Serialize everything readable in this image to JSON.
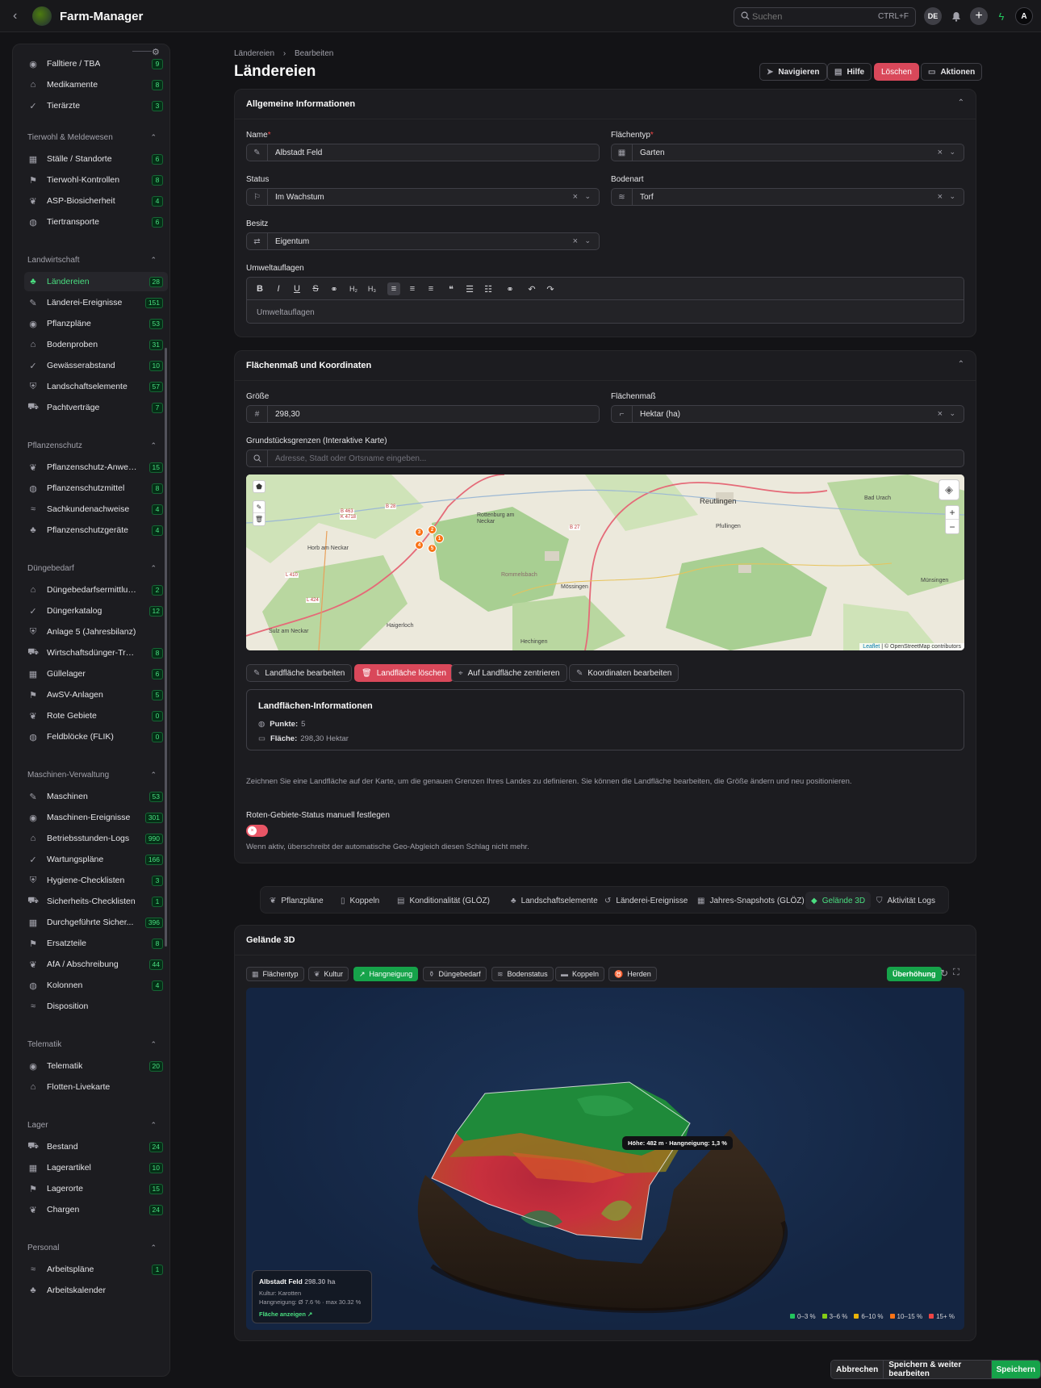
{
  "app": {
    "title": "Farm-Manager",
    "back_icon": "chevron-left-icon"
  },
  "topbar": {
    "search_placeholder": "Suchen",
    "search_shortcut": "CTRL+F",
    "lang": "DE",
    "avatar": "A"
  },
  "sidebar": {
    "items_top": [
      {
        "label": "Falltiere / TBA",
        "count": "9",
        "icon": "skull-icon"
      },
      {
        "label": "Medikamente",
        "count": "8",
        "icon": "pill-icon"
      },
      {
        "label": "Tierärzte",
        "count": "3",
        "icon": "stethoscope-icon"
      }
    ],
    "sections": [
      {
        "title": "Tierwohl & Meldewesen",
        "items": [
          {
            "label": "Ställe / Standorte",
            "count": "6"
          },
          {
            "label": "Tierwohl-Kontrollen",
            "count": "8"
          },
          {
            "label": "ASP-Biosicherheit",
            "count": "4"
          },
          {
            "label": "Tiertransporte",
            "count": "6"
          }
        ]
      },
      {
        "title": "Landwirtschaft",
        "items": [
          {
            "label": "Ländereien",
            "count": "28",
            "active": true
          },
          {
            "label": "Länderei-Ereignisse",
            "count": "151"
          },
          {
            "label": "Pflanzpläne",
            "count": "53"
          },
          {
            "label": "Bodenproben",
            "count": "31"
          },
          {
            "label": "Gewässerabstand",
            "count": "10"
          },
          {
            "label": "Landschaftselemente",
            "count": "57"
          },
          {
            "label": "Pachtverträge",
            "count": "7"
          }
        ]
      },
      {
        "title": "Pflanzenschutz",
        "items": [
          {
            "label": "Pflanzenschutz-Anwen...",
            "count": "15"
          },
          {
            "label": "Pflanzenschutzmittel",
            "count": "8"
          },
          {
            "label": "Sachkundenachweise",
            "count": "4"
          },
          {
            "label": "Pflanzenschutzgeräte",
            "count": "4"
          }
        ]
      },
      {
        "title": "Düngebedarf",
        "items": [
          {
            "label": "Düngebedarfsermittlung",
            "count": "2"
          },
          {
            "label": "Düngerkatalog",
            "count": "12"
          },
          {
            "label": "Anlage 5 (Jahresbilanz)",
            "count": ""
          },
          {
            "label": "Wirtschaftsdünger-Tran...",
            "count": "8"
          },
          {
            "label": "Güllelager",
            "count": "6"
          },
          {
            "label": "AwSV-Anlagen",
            "count": "5"
          },
          {
            "label": "Rote Gebiete",
            "count": "0"
          },
          {
            "label": "Feldblöcke (FLIK)",
            "count": "0"
          }
        ]
      },
      {
        "title": "Maschinen-Verwaltung",
        "items": [
          {
            "label": "Maschinen",
            "count": "53"
          },
          {
            "label": "Maschinen-Ereignisse",
            "count": "301"
          },
          {
            "label": "Betriebsstunden-Logs",
            "count": "990"
          },
          {
            "label": "Wartungspläne",
            "count": "166"
          },
          {
            "label": "Hygiene-Checklisten",
            "count": "3"
          },
          {
            "label": "Sicherheits-Checklisten",
            "count": "1"
          },
          {
            "label": "Durchgeführte Sicher...",
            "count": "396"
          },
          {
            "label": "Ersatzteile",
            "count": "8"
          },
          {
            "label": "AfA / Abschreibung",
            "count": "44"
          },
          {
            "label": "Kolonnen",
            "count": "4"
          },
          {
            "label": "Disposition",
            "count": ""
          }
        ]
      },
      {
        "title": "Telematik",
        "items": [
          {
            "label": "Telematik",
            "count": "20"
          },
          {
            "label": "Flotten-Livekarte",
            "count": ""
          }
        ]
      },
      {
        "title": "Lager",
        "items": [
          {
            "label": "Bestand",
            "count": "24"
          },
          {
            "label": "Lagerartikel",
            "count": "10"
          },
          {
            "label": "Lagerorte",
            "count": "15"
          },
          {
            "label": "Chargen",
            "count": "24"
          }
        ]
      },
      {
        "title": "Personal",
        "items": [
          {
            "label": "Arbeitspläne",
            "count": "1"
          },
          {
            "label": "Arbeitskalender",
            "count": ""
          }
        ]
      }
    ]
  },
  "page": {
    "breadcrumb_1": "Ländereien",
    "breadcrumb_2": "Bearbeiten",
    "title": "Ländereien",
    "btn_navigate": "Navigieren",
    "btn_help": "Hilfe",
    "btn_delete": "Löschen",
    "btn_actions": "Aktionen"
  },
  "general": {
    "title": "Allgemeine Informationen",
    "name_label": "Name",
    "name_value": "Albstadt Feld",
    "area_type_label": "Flächentyp",
    "area_type_value": "Garten",
    "status_label": "Status",
    "status_value": "Im Wachstum",
    "soil_label": "Bodenart",
    "soil_value": "Torf",
    "ownership_label": "Besitz",
    "ownership_value": "Eigentum",
    "env_label": "Umweltauflagen",
    "env_placeholder": "Umweltauflagen"
  },
  "measure": {
    "title": "Flächenmaß und Koordinaten",
    "size_label": "Größe",
    "size_value": "298,30",
    "unit_label": "Flächenmaß",
    "unit_value": "Hektar (ha)",
    "map_label": "Grundstücksgrenzen (Interaktive Karte)",
    "address_placeholder": "Adresse, Stadt oder Ortsname eingeben...",
    "map_places": [
      "Reutlingen",
      "Bad Urach",
      "Rottenburg am Neckar",
      "Horb am Neckar",
      "Pfullingen",
      "Mössingen",
      "Hechingen",
      "Haigerloch",
      "Sulz am Neckar",
      "Münsingen",
      "Rommelsbach"
    ],
    "map_roads": [
      "B 463",
      "B 28",
      "B 27",
      "L 410",
      "L 424",
      "K 4718"
    ],
    "markers": [
      "1",
      "2",
      "3",
      "4",
      "5"
    ],
    "attribution_link": "Leaflet",
    "attribution_text": "| © OpenStreetMap contributors",
    "btn_edit": "Landfläche bearbeiten",
    "btn_delete": "Landfläche löschen",
    "btn_center": "Auf Landfläche zentrieren",
    "btn_coords": "Koordinaten bearbeiten",
    "info_title": "Landflächen-Informationen",
    "points_label": "Punkte:",
    "points_value": "5",
    "area_label": "Fläche:",
    "area_value": "298,30 Hektar",
    "help": "Zeichnen Sie eine Landfläche auf der Karte, um die genauen Grenzen Ihres Landes zu definieren. Sie können die Landfläche bearbeiten, die Größe ändern und neu positionieren.",
    "red_label": "Roten-Gebiete-Status manuell festlegen",
    "red_help": "Wenn aktiv, überschreibt der automatische Geo-Abgleich diesen Schlag nicht mehr."
  },
  "tabs": [
    "Pflanzpläne",
    "Koppeln",
    "Konditionalität (GLÖZ)",
    "Landschaftselemente",
    "Länderei-Ereignisse",
    "Jahres-Snapshots (GLÖZ)",
    "Gelände 3D",
    "Aktivität Logs"
  ],
  "terrain": {
    "title": "Gelände 3D",
    "chips": [
      "Flächentyp",
      "Kultur",
      "Hangneigung",
      "Düngebedarf",
      "Bodenstatus",
      "Koppeln",
      "Herden"
    ],
    "exaggeration": "Überhöhung",
    "tooltip": "Höhe: 482 m · Hangneigung: 1,3 %",
    "info_name": "Albstadt Feld",
    "info_area": "298.30 ha",
    "info_culture": "Kultur: Karotten",
    "info_slope": "Hangneigung: Ø 7.6 % · max 30.32 %",
    "info_link": "Fläche anzeigen ↗",
    "legend": [
      {
        "label": "0–3 %",
        "color": "#22c55e"
      },
      {
        "label": "3–6 %",
        "color": "#84cc16"
      },
      {
        "label": "6–10 %",
        "color": "#eab308"
      },
      {
        "label": "10–15 %",
        "color": "#f97316"
      },
      {
        "label": "15+ %",
        "color": "#ef4444"
      }
    ]
  },
  "footer": {
    "cancel": "Abbrechen",
    "save_continue": "Speichern & weiter bearbeiten",
    "save": "Speichern"
  }
}
